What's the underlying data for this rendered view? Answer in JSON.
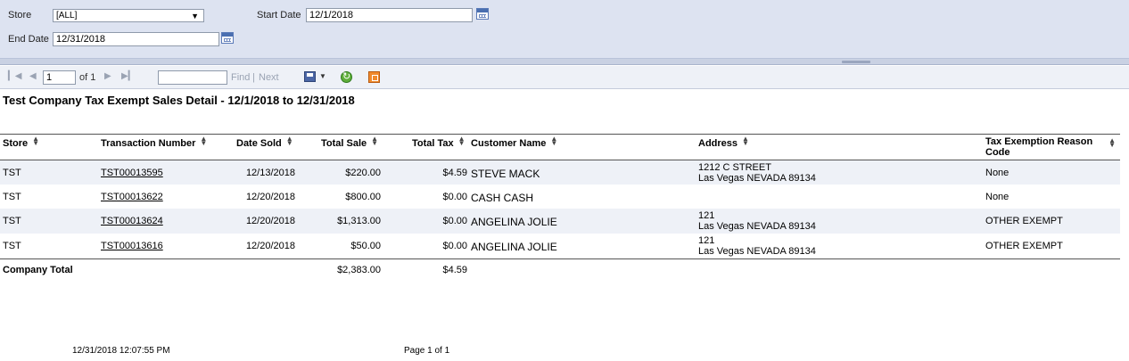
{
  "params": {
    "store_label": "Store",
    "store_value": "[ALL]",
    "start_label": "Start Date",
    "start_value": "12/1/2018",
    "end_label": "End Date",
    "end_value": "12/31/2018"
  },
  "toolbar": {
    "page_value": "1",
    "of_text": "of 1",
    "find_label": "Find",
    "separator": "|",
    "next_label": "Next",
    "find_value": ""
  },
  "report": {
    "title": "Test Company Tax Exempt Sales Detail - 12/1/2018 to 12/31/2018",
    "columns": {
      "store": "Store",
      "transaction": "Transaction Number",
      "date_sold": "Date Sold",
      "total_sale": "Total Sale",
      "total_tax": "Total Tax",
      "customer": "Customer Name",
      "address": "Address",
      "reason_1": "Tax Exemption Reason",
      "reason_2": "Code"
    },
    "rows": [
      {
        "store": "TST",
        "transaction": "TST00013595",
        "date": "12/13/2018",
        "sale": "$220.00",
        "tax": "$4.59",
        "customer": "STEVE MACK",
        "addr1": "1212 C STREET",
        "addr2": "Las Vegas NEVADA 89134",
        "reason": "None"
      },
      {
        "store": "TST",
        "transaction": "TST00013622",
        "date": "12/20/2018",
        "sale": "$800.00",
        "tax": "$0.00",
        "customer": "CASH CASH",
        "addr1": "",
        "addr2": "",
        "reason": "None"
      },
      {
        "store": "TST",
        "transaction": "TST00013624",
        "date": "12/20/2018",
        "sale": "$1,313.00",
        "tax": "$0.00",
        "customer": "ANGELINA JOLIE",
        "addr1": "121",
        "addr2": "Las Vegas NEVADA 89134",
        "reason": "OTHER EXEMPT"
      },
      {
        "store": "TST",
        "transaction": "TST00013616",
        "date": "12/20/2018",
        "sale": "$50.00",
        "tax": "$0.00",
        "customer": "ANGELINA JOLIE",
        "addr1": "121",
        "addr2": "Las Vegas NEVADA 89134",
        "reason": "OTHER EXEMPT"
      }
    ],
    "total": {
      "label": "Company Total",
      "sale": "$2,383.00",
      "tax": "$4.59"
    },
    "footer": {
      "timestamp": "12/31/2018 12:07:55 PM",
      "page": "Page 1 of 1"
    }
  },
  "colors": {
    "param_panel": "#dde3f1",
    "row_shade": "#eef1f7",
    "toolbar": "#eef1f7"
  }
}
